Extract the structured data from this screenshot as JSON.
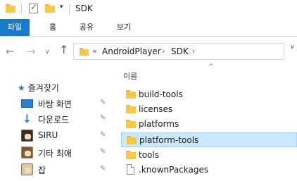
{
  "window": {
    "title": "SDK",
    "quick_access_dropdown": "▾"
  },
  "ribbon": {
    "tabs": [
      {
        "label": "파일"
      },
      {
        "label": "홈"
      },
      {
        "label": "공유"
      },
      {
        "label": "보기"
      }
    ]
  },
  "navigation": {
    "back": "←",
    "forward": "→",
    "recent": "∨",
    "up": "↑"
  },
  "address": {
    "overflow": "«",
    "crumbs": [
      {
        "label": "AndroidPlayer"
      },
      {
        "label": "SDK"
      }
    ],
    "separator": "›",
    "dropdown": "∨"
  },
  "sidebar": {
    "quick_access_label": "즐겨찾기",
    "items": [
      {
        "label": "바탕 화면",
        "icon": "desktop-icon"
      },
      {
        "label": "다운로드",
        "icon": "download-icon"
      },
      {
        "label": "SIRU",
        "icon": "avatar-icon"
      },
      {
        "label": "기타 최애",
        "icon": "avatar-icon"
      },
      {
        "label": "잡",
        "icon": "avatar-icon"
      }
    ],
    "pin_glyph": "📌"
  },
  "content": {
    "column_header": "이름",
    "sort_indicator": "^",
    "files": [
      {
        "name": "build-tools",
        "type": "folder",
        "selected": false
      },
      {
        "name": "licenses",
        "type": "folder",
        "selected": false
      },
      {
        "name": "platforms",
        "type": "folder",
        "selected": false
      },
      {
        "name": "platform-tools",
        "type": "folder",
        "selected": true
      },
      {
        "name": "tools",
        "type": "folder",
        "selected": false
      },
      {
        "name": ".knownPackages",
        "type": "file",
        "selected": false
      }
    ]
  },
  "colors": {
    "file_tab": "#1979ca",
    "selection_bg": "#cce8ff",
    "selection_border": "#99d1ff",
    "folder": "#f5c84c"
  }
}
